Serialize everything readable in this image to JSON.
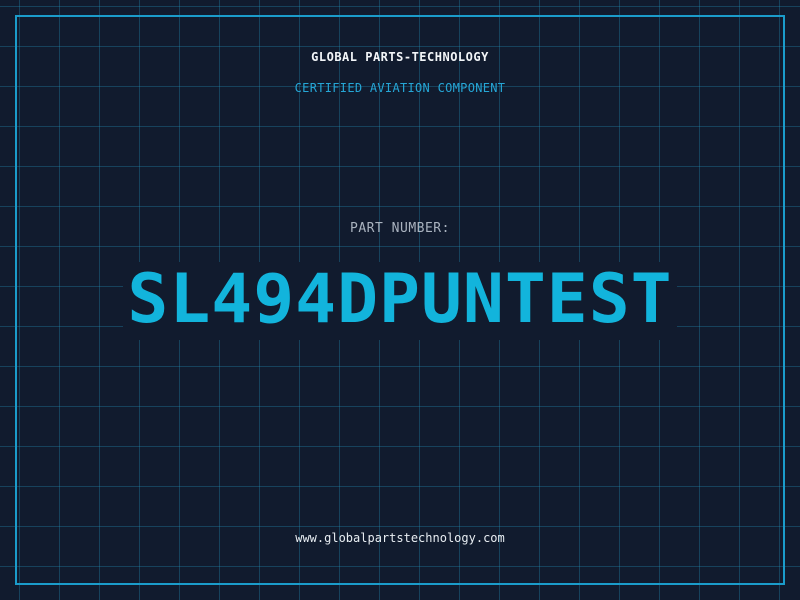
{
  "header": {
    "company": "GLOBAL PARTS-TECHNOLOGY",
    "subtitle": "CERTIFIED AVIATION COMPONENT"
  },
  "part": {
    "label": "PART NUMBER:",
    "number": "SL494DPUNTEST"
  },
  "footer": {
    "url": "www.globalpartstechnology.com"
  },
  "colors": {
    "background": "#111b2e",
    "grid": "#1d6f8f",
    "frame": "#1b9ccb",
    "accent": "#12b4dc",
    "subtitle": "#25a6d6",
    "label": "#aab3bf",
    "text": "#f2f5f8"
  }
}
